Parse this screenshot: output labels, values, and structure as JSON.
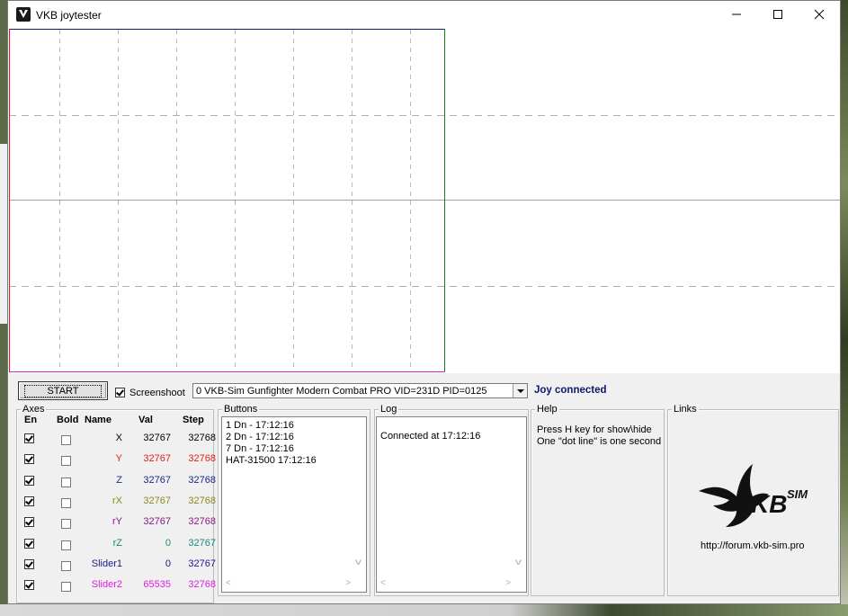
{
  "window": {
    "title": "VKB joytester",
    "buttons": {
      "minimize": "minimize",
      "maximize": "maximize",
      "close": "close"
    }
  },
  "plot": {
    "grid": true,
    "line_color_x": "#0b1a6b",
    "line_color_green": "#1f7a1f",
    "line_color_magenta": "#d12bd1"
  },
  "toolbar": {
    "start_label": "START",
    "screenshoot_label": "Screenshoot",
    "screenshoot_checked": true,
    "device_selected": "0  VKB-Sim Gunfighter Modern Combat PRO  VID=231D PID=0125",
    "status": "Joy connected"
  },
  "axes": {
    "title": "Axes",
    "headers": {
      "en": "En",
      "bold": "Bold",
      "name": "Name",
      "val": "Val",
      "step": "Step"
    },
    "rows": [
      {
        "name": "X",
        "val": "32767",
        "step": "32768",
        "color": "#000000",
        "enabled": true,
        "bold": false
      },
      {
        "name": "Y",
        "val": "32767",
        "step": "32768",
        "color": "#e02020",
        "enabled": true,
        "bold": false
      },
      {
        "name": "Z",
        "val": "32767",
        "step": "32768",
        "color": "#1a2a8a",
        "enabled": true,
        "bold": false
      },
      {
        "name": "rX",
        "val": "32767",
        "step": "32768",
        "color": "#8a8a20",
        "enabled": true,
        "bold": false
      },
      {
        "name": "rY",
        "val": "32767",
        "step": "32768",
        "color": "#8a1a8a",
        "enabled": true,
        "bold": false
      },
      {
        "name": "rZ",
        "val": "0",
        "step": "32767",
        "color": "#1a8a7a",
        "enabled": true,
        "bold": false
      },
      {
        "name": "Slider1",
        "val": "0",
        "step": "32767",
        "color": "#1a1a8a",
        "enabled": true,
        "bold": false
      },
      {
        "name": "Slider2",
        "val": "65535",
        "step": "32768",
        "color": "#e020e0",
        "enabled": true,
        "bold": false
      }
    ]
  },
  "buttons_panel": {
    "title": "Buttons",
    "lines": [
      "1 Dn - 17:12:16",
      "2 Dn - 17:12:16",
      "7 Dn - 17:12:16",
      "HAT-31500 17:12:16"
    ]
  },
  "log_panel": {
    "title": "Log",
    "lines": [
      "Connected at 17:12:16"
    ]
  },
  "help_panel": {
    "title": "Help",
    "lines": [
      "Press H key for show\\hide",
      "One \"dot line\" is one second"
    ]
  },
  "links_panel": {
    "title": "Links",
    "logo_text": "VKB SIM",
    "url": "http://forum.vkb-sim.pro"
  }
}
